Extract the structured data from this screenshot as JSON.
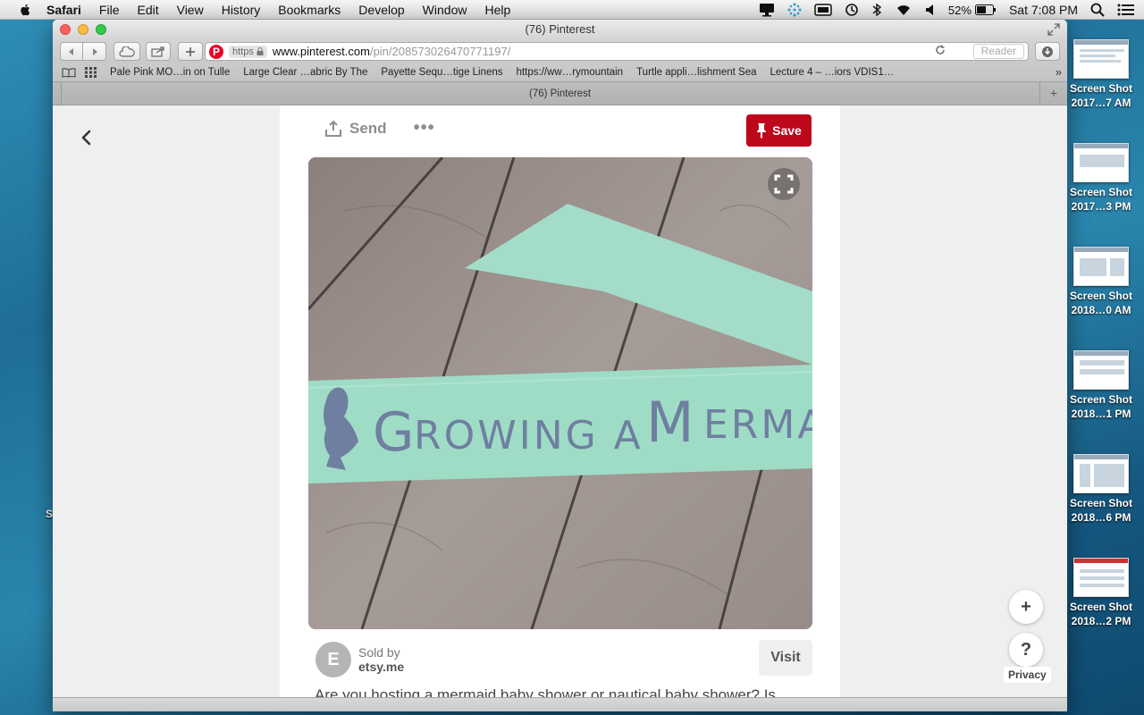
{
  "menubar": {
    "app_name": "Safari",
    "items": [
      "File",
      "Edit",
      "View",
      "History",
      "Bookmarks",
      "Develop",
      "Window",
      "Help"
    ],
    "battery": "52%",
    "clock": "Sat 7:08 PM"
  },
  "window": {
    "title": "(76) Pinterest"
  },
  "toolbar": {
    "address": {
      "scheme_badge": "https",
      "host": "www.pinterest.com",
      "path": "/pin/208573026470771197/"
    },
    "reader_label": "Reader"
  },
  "bookmarks": [
    "Pale Pink MO…in on Tulle",
    "Large Clear …abric By The",
    "Payette Sequ…tige Linens",
    "https://ww…rymountain",
    "Turtle appli…lishment Sea",
    "Lecture 4 – …iors VDIS1…"
  ],
  "tab": {
    "title": "(76) Pinterest"
  },
  "pin": {
    "send_label": "Send",
    "save_label": "Save",
    "seller": {
      "avatar_letter": "E",
      "sold_by_label": "Sold by",
      "name": "etsy.me"
    },
    "visit_label": "Visit",
    "description": "Are you hosting a mermaid baby shower or nautical baby shower? Is"
  },
  "floating": {
    "plus_label": "+",
    "help_label": "?",
    "privacy_label": "Privacy"
  },
  "desktop": {
    "left_edge_label": "S",
    "screenshots": [
      {
        "line1": "Screen Shot",
        "line2": "2017…7 AM"
      },
      {
        "line1": "Screen Shot",
        "line2": "2017…3 PM"
      },
      {
        "line1": "Screen Shot",
        "line2": "2018…0 AM"
      },
      {
        "line1": "Screen Shot",
        "line2": "2018…1 PM"
      },
      {
        "line1": "Screen Shot",
        "line2": "2018…6 PM"
      },
      {
        "line1": "Screen Shot",
        "line2": "2018…2 PM"
      }
    ]
  },
  "colors": {
    "pinterest_red": "#bd081c",
    "ribbon_mint": "#9fdcc6",
    "ribbon_text": "#6f7fa0"
  }
}
